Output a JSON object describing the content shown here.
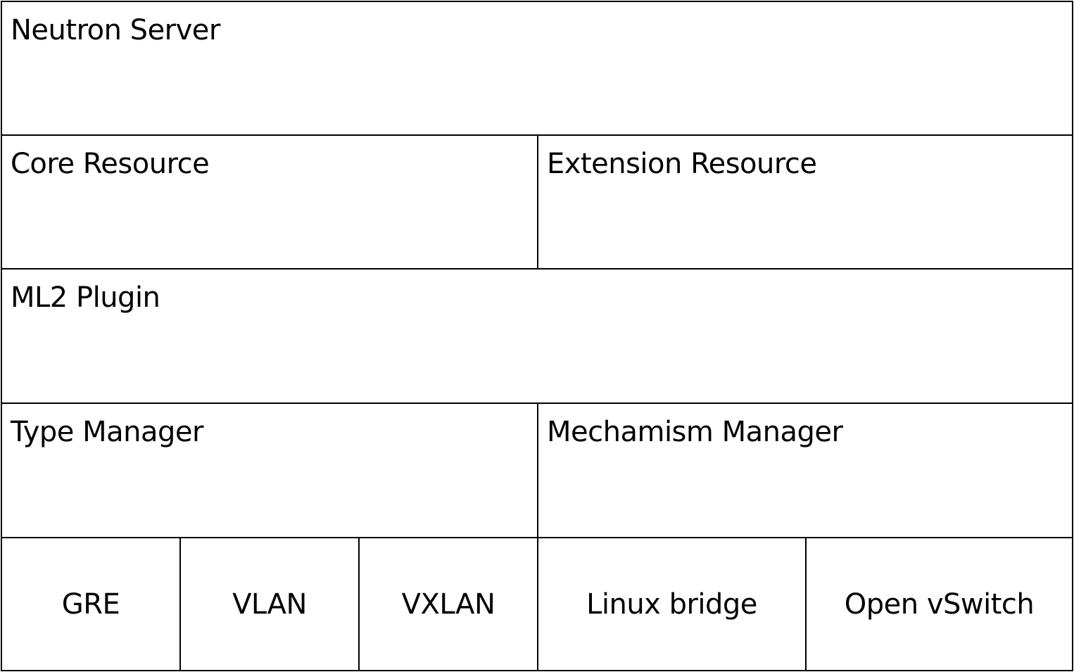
{
  "rows": {
    "neutron_server": "Neutron Server",
    "core_resource": "Core Resource",
    "extension_resource": "Extension Resource",
    "ml2_plugin": "ML2 Plugin",
    "type_manager": "Type Manager",
    "mechanism_manager": "Mechamism Manager"
  },
  "drivers": {
    "type": [
      "GRE",
      "VLAN",
      "VXLAN"
    ],
    "mechanism": [
      "Linux bridge",
      "Open vSwitch"
    ]
  }
}
